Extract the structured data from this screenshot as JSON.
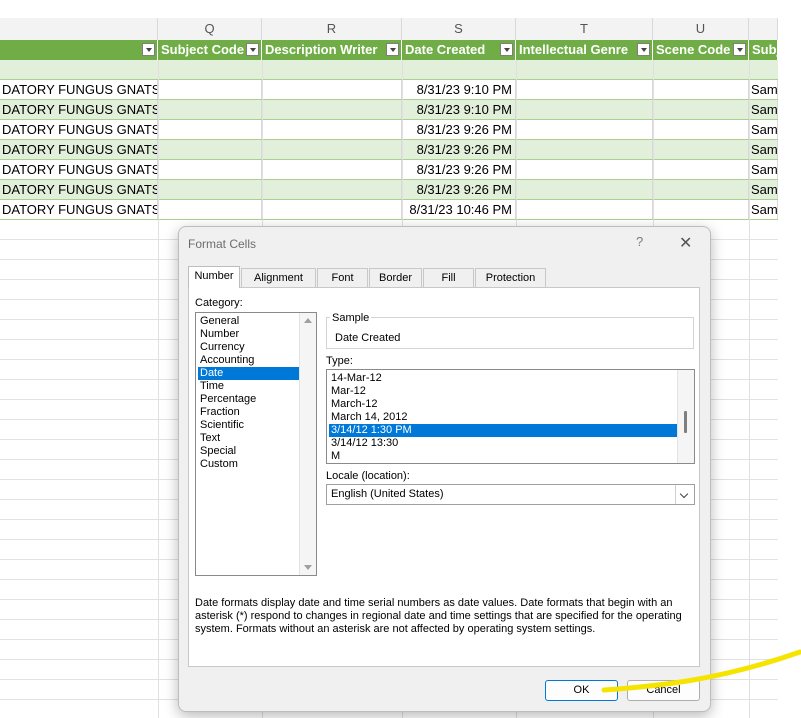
{
  "sheet": {
    "columns": [
      {
        "letter": "Q"
      },
      {
        "letter": "R"
      },
      {
        "letter": "S"
      },
      {
        "letter": "T"
      },
      {
        "letter": "U"
      }
    ],
    "headers": [
      "",
      "Subject Code",
      "Description Writer",
      "Date Created",
      "Intellectual Genre",
      "Scene Code",
      "Subj"
    ],
    "rows": [
      {
        "name": "DATORY FUNGUS GNATS",
        "date": "8/31/23 9:10 PM",
        "other": "Sam"
      },
      {
        "name": "DATORY FUNGUS GNATS",
        "date": "8/31/23 9:10 PM",
        "other": "Sam"
      },
      {
        "name": "DATORY FUNGUS GNATS",
        "date": "8/31/23 9:26 PM",
        "other": "Sam"
      },
      {
        "name": "DATORY FUNGUS GNATS",
        "date": "8/31/23 9:26 PM",
        "other": "Sam"
      },
      {
        "name": "DATORY FUNGUS GNATS",
        "date": "8/31/23 9:26 PM",
        "other": "Sam"
      },
      {
        "name": "DATORY FUNGUS GNATS",
        "date": "8/31/23 9:26 PM",
        "other": "Sam"
      },
      {
        "name": "DATORY FUNGUS GNATS",
        "date": "8/31/23 10:46 PM",
        "other": "Sam"
      }
    ],
    "colors": {
      "header_bg": "#70ad47",
      "band_bg": "#e2efda"
    }
  },
  "dialog": {
    "title": "Format Cells",
    "help": "?",
    "close": "✕",
    "tabs": [
      "Number",
      "Alignment",
      "Font",
      "Border",
      "Fill",
      "Protection"
    ],
    "active_tab": "Number",
    "category_label": "Category:",
    "categories": [
      "General",
      "Number",
      "Currency",
      "Accounting",
      "Date",
      "Time",
      "Percentage",
      "Fraction",
      "Scientific",
      "Text",
      "Special",
      "Custom"
    ],
    "selected_category": "Date",
    "sample_label": "Sample",
    "sample_value": "Date Created",
    "type_label": "Type:",
    "types": [
      "14-Mar-12",
      "Mar-12",
      "March-12",
      "March 14, 2012",
      "3/14/12 1:30 PM",
      "3/14/12 13:30",
      "M"
    ],
    "selected_type": "3/14/12 1:30 PM",
    "locale_label": "Locale (location):",
    "locale_value": "English (United States)",
    "description": "Date formats display date and time serial numbers as date values.  Date formats that begin with an asterisk (*) respond to changes in regional date and time settings that are specified for the operating system. Formats without an asterisk are not affected by operating system settings.",
    "ok_label": "OK",
    "cancel_label": "Cancel",
    "accent": "#0078d7"
  },
  "annotation": {
    "color": "#f5e400"
  }
}
